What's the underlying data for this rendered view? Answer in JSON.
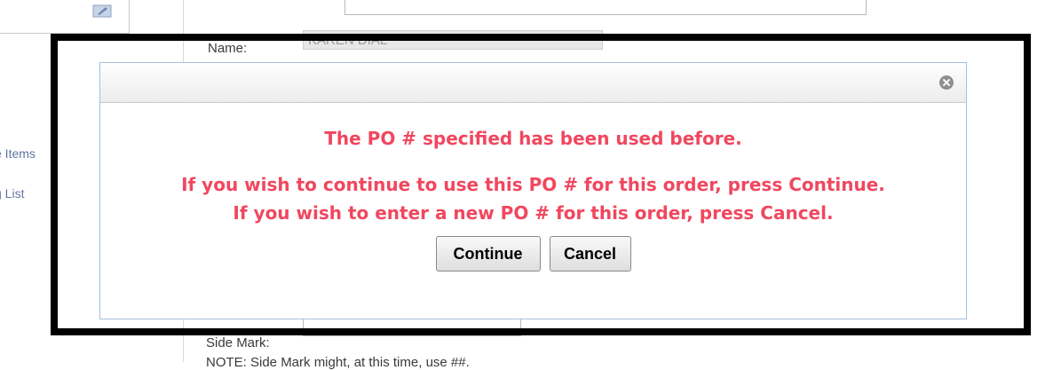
{
  "background": {
    "name_label": "Name:",
    "name_value": "KAREN DIAL",
    "side_links": [
      "e Items",
      "g List"
    ],
    "side_mark_label": "Side Mark:",
    "note_text": "NOTE: Side Mark might, at this time, use ##."
  },
  "dialog": {
    "message_line1": "The PO # specified has been used before.",
    "message_line2": "If you wish to continue to use this PO # for this order, press Continue.",
    "message_line3": "If you wish to enter a new PO # for this order, press Cancel.",
    "continue_label": "Continue",
    "cancel_label": "Cancel",
    "close_icon": "close-icon"
  },
  "colors": {
    "message_red": "#f0475f",
    "dialog_border": "#a5c0de",
    "frame": "#000000"
  }
}
